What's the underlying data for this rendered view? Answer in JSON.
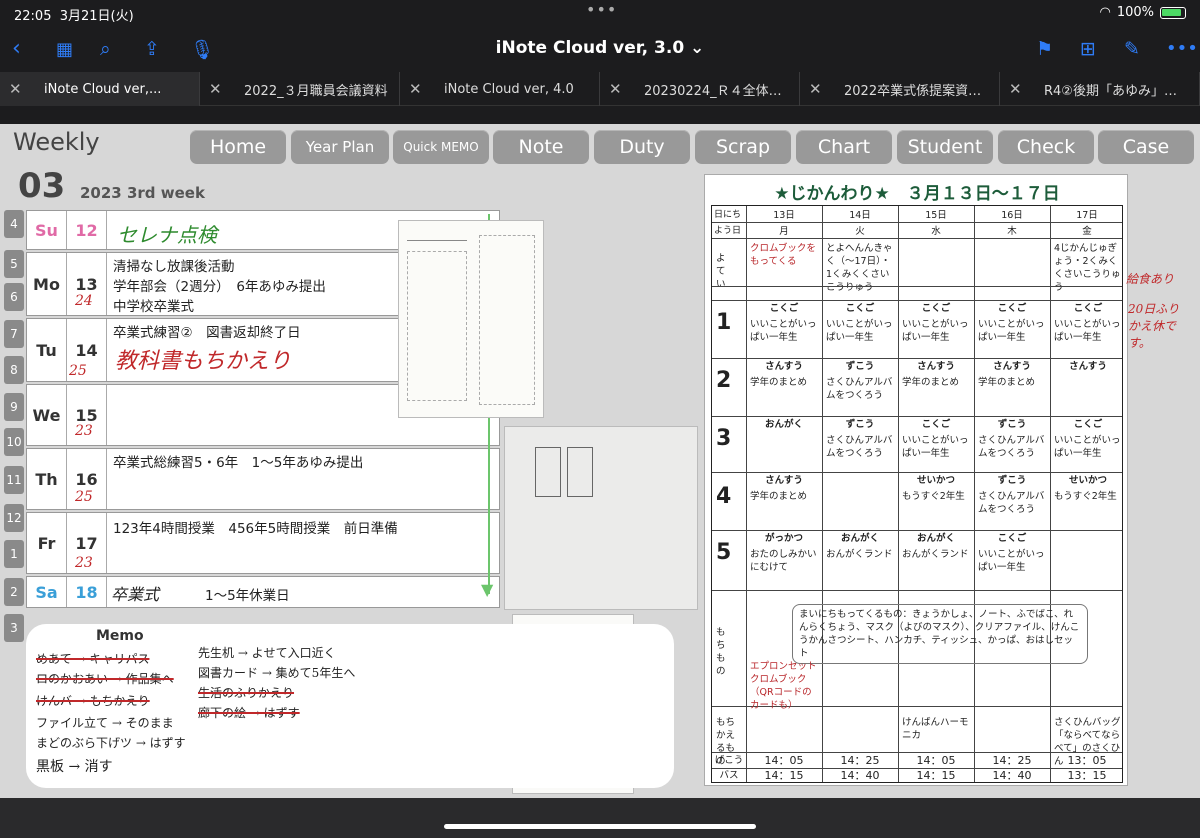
{
  "status": {
    "time": "22:05",
    "date": "3月21日(火)",
    "battery": "100%"
  },
  "toolbar": {
    "title": "iNote Cloud ver, 3.0 ⌄"
  },
  "tabs": [
    {
      "label": "iNote Cloud ver,..."
    },
    {
      "label": "2022_３月職員会議資料"
    },
    {
      "label": "iNote Cloud ver, 4.0"
    },
    {
      "label": "20230224_Ｒ４全体…"
    },
    {
      "label": "2022卒業式係提案資…"
    },
    {
      "label": "R4②後期「あゆみ」…"
    }
  ],
  "page": {
    "heading": "Weekly",
    "week_num": "03",
    "week_label": "2023 3rd week",
    "nav": [
      "Home",
      "Year Plan",
      "Quick MEMO",
      "Note",
      "Duty",
      "Scrap",
      "Chart",
      "Student",
      "Check",
      "Case"
    ],
    "hours": [
      "4",
      "5",
      "6",
      "7",
      "8",
      "9",
      "10",
      "11",
      "12",
      "1",
      "2",
      "3"
    ],
    "days": [
      {
        "day": "Su",
        "date": "12",
        "color": "#e06aa6",
        "lines": [],
        "hand": "セレナ点検"
      },
      {
        "day": "Mo",
        "date": "13",
        "color": "#333333",
        "lines": [
          "清掃なし放課後活動",
          "学年部会（2週分）　6年あゆみ提出",
          "中学校卒業式"
        ],
        "hand": "24"
      },
      {
        "day": "Tu",
        "date": "14",
        "color": "#333333",
        "lines": [
          "卒業式練習②　図書返却終了日"
        ],
        "hand": "教科書もちかえり"
      },
      {
        "day": "We",
        "date": "15",
        "color": "#333333",
        "lines": [],
        "hand": "23"
      },
      {
        "day": "Th",
        "date": "16",
        "color": "#333333",
        "lines": [
          "卒業式総練習5・6年　1〜5年あゆみ提出"
        ],
        "hand": "25"
      },
      {
        "day": "Fr",
        "date": "17",
        "color": "#333333",
        "lines": [
          "123年4時間授業　456年5時間授業　前日準備"
        ],
        "hand": "23"
      },
      {
        "day": "Sa",
        "date": "18",
        "color": "#3a9fd8",
        "lines": [
          "1〜5年休業日"
        ],
        "hand": "卒業式"
      }
    ],
    "memo": {
      "title": "Memo",
      "left": [
        "めあて → キャリパス",
        "ロのかおあい → 作品集へ",
        "けんバ → もちかえり",
        "ファイル立て → そのまま",
        "まどのぶら下げツ → はずす",
        "黒板 → 消す"
      ],
      "right": [
        "先生机 → よせて入口近く",
        "図書カード → 集めて5年生へ",
        "生活のふりかえり",
        "廊下の絵 → はずす"
      ]
    },
    "sheet": {
      "title": "★じかんわり★　３月１３日〜１７日",
      "hdr_date": "日にち",
      "hdr_dow": "よう日",
      "dates": [
        "13日",
        "14日",
        "15日",
        "16日",
        "17日"
      ],
      "dows": [
        "月",
        "火",
        "水",
        "木",
        "金"
      ],
      "yotei_label": "よてい",
      "yotei": [
        "クロムブックをもってくる",
        "とよへんんきゃく（〜17日）・1くみくくさいこうりゅう",
        "",
        "",
        "4じかんじゅぎょう・2くみくくさいこうりゅう"
      ],
      "periods": [
        "1",
        "2",
        "3",
        "4",
        "5"
      ],
      "subjects": [
        [
          "こくご",
          "こくご",
          "こくご",
          "こくご",
          "こくご"
        ],
        [
          "さんすう",
          "ずこう",
          "さんすう",
          "さんすう",
          "さんすう"
        ],
        [
          "おんがく",
          "ずこう",
          "こくご",
          "ずこう",
          "こくご"
        ],
        [
          "さんすう",
          "",
          "せいかつ",
          "ずこう",
          "せいかつ"
        ],
        [
          "がっかつ",
          "おんがく",
          "おんがく",
          "こくご",
          ""
        ]
      ],
      "details": [
        [
          "いいことがいっぱい一年生",
          "いいことがいっぱい一年生",
          "いいことがいっぱい一年生",
          "いいことがいっぱい一年生",
          "いいことがいっぱい一年生"
        ],
        [
          "学年のまとめ",
          "さくひんアルバムをつくろう",
          "学年のまとめ",
          "学年のまとめ",
          ""
        ],
        [
          "",
          "さくひんアルバムをつくろう",
          "いいことがいっぱい一年生",
          "さくひんアルバムをつくろう",
          "いいことがいっぱい一年生"
        ],
        [
          "学年のまとめ",
          "",
          "もうすぐ2年生",
          "さくひんアルバムをつくろう",
          "もうすぐ2年生"
        ],
        [
          "おたのしみかいにむけて",
          "おんがくランド",
          "おんがくランド",
          "いいことがいっぱい一年生",
          ""
        ]
      ],
      "mochimono_label": "もちもの",
      "mochimono": "まいにちもってくるもの：きょうかしょ、ノート、ふでばこ、れんらくちょう、マスク（よびのマスク）、クリアファイル、けんこうかんさつシート、ハンカチ、ティッシュ、かっぱ、おはしセット",
      "mochikaeru_label": "もちかえるもの",
      "mochikaeru": [
        "エプロンセット クロムブック（QRコードのカードも）",
        "",
        "けんばんハーモニカ",
        "",
        "さくひんバッグ「ならべてならべて」のさくひん"
      ],
      "gekou_label": "げこう",
      "bus_label": "バス",
      "gekou": [
        "14：05",
        "14：25",
        "14：05",
        "14：25",
        "13：05"
      ],
      "bus": [
        "14：15",
        "14：40",
        "14：15",
        "14：40",
        "13：15"
      ],
      "hand_notes": [
        "給食あり",
        "20日ふりかえ休です。"
      ]
    }
  }
}
